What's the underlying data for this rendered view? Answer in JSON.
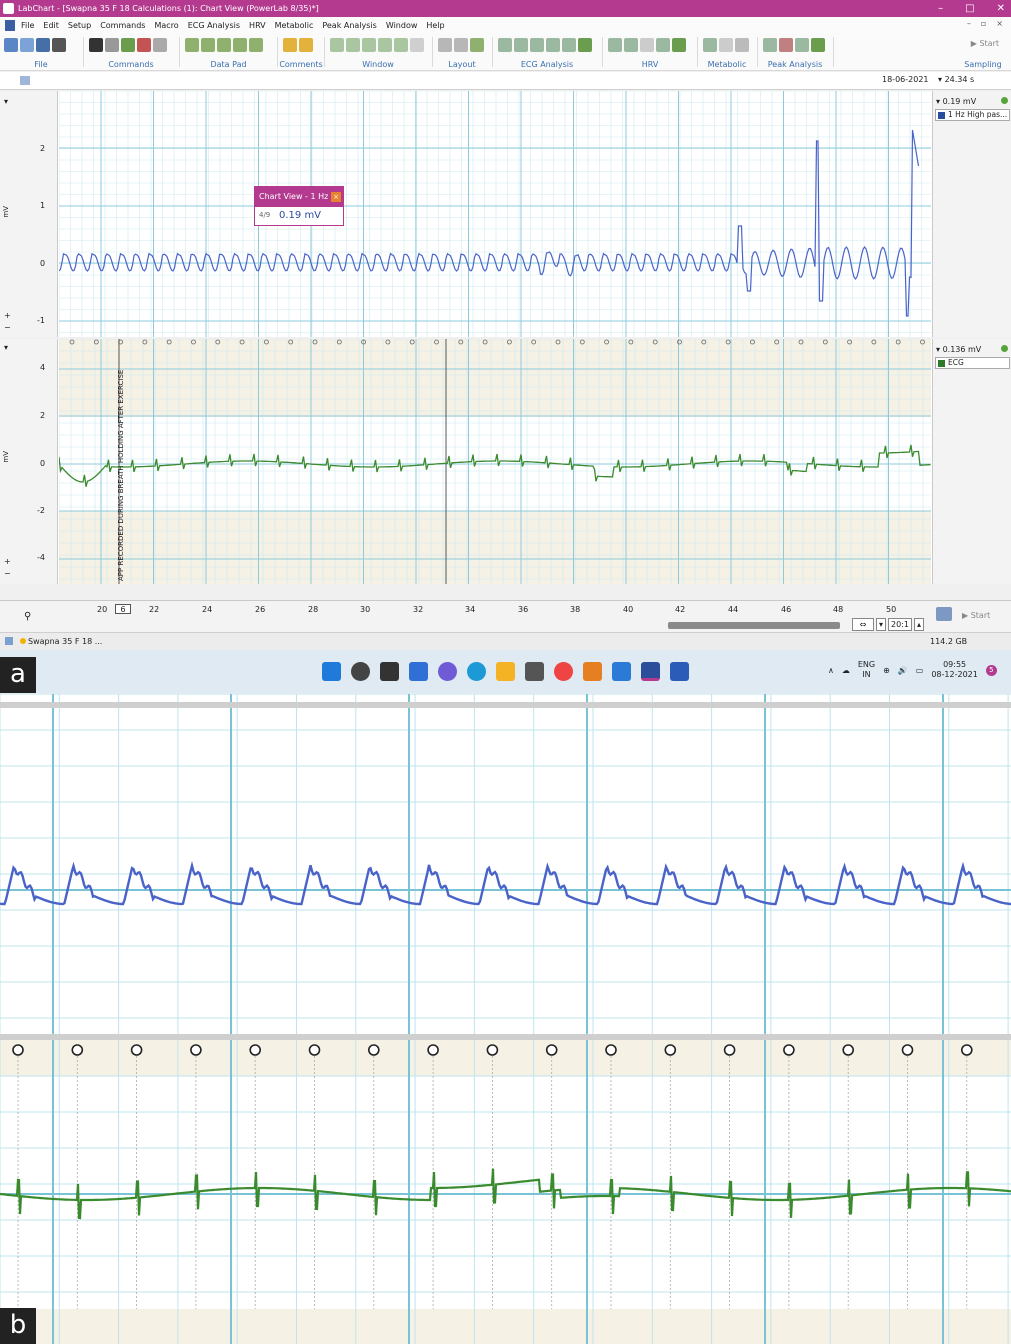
{
  "window": {
    "title": "LabChart - [Swapna 35 F 18 Calculations (1): Chart View (PowerLab 8/35)*]",
    "controls": [
      "–",
      "□",
      "✕"
    ]
  },
  "menu": [
    "File",
    "Edit",
    "Setup",
    "Commands",
    "Macro",
    "ECG Analysis",
    "HRV",
    "Metabolic",
    "Peak Analysis",
    "Window",
    "Help"
  ],
  "ribbon": {
    "groups": [
      "File",
      "Commands",
      "Data Pad",
      "Comments",
      "Window",
      "Layout",
      "ECG Analysis",
      "HRV",
      "Metabolic",
      "Peak Analysis",
      "Sampling"
    ],
    "start_label": "Start"
  },
  "date_bar": {
    "date": "18-06-2021",
    "duration": "24.34 s"
  },
  "channel1": {
    "unit": "mV",
    "ticks": [
      "2",
      "1",
      "0",
      "-1"
    ],
    "value": "0.19 mV",
    "selector": "1 Hz High pas...",
    "color": "#4a63c8"
  },
  "channel2": {
    "unit": "mV",
    "ticks": [
      "4",
      "2",
      "0",
      "-2",
      "-4"
    ],
    "value": "0.136 mV",
    "selector": "ECG",
    "color": "#3a8a2e",
    "comment": "APP RECORDED DURING BREATH HOLDING AFTER EXERCISE"
  },
  "popup": {
    "title": "Chart View - 1 Hz ...",
    "value": "0.19 mV",
    "icon": "4/9"
  },
  "time_axis": {
    "ticks": [
      "20",
      "22",
      "24",
      "26",
      "28",
      "30",
      "32",
      "34",
      "36",
      "38",
      "40",
      "42",
      "44",
      "46",
      "48",
      "50"
    ],
    "cursor_value": "6",
    "zoom_ratio": "20:1",
    "start_label": "Start"
  },
  "status": {
    "document": "Swapna 35 F 18 ...",
    "disk": "114.2 GB"
  },
  "taskbar": {
    "lang_top": "ENG",
    "lang_bottom": "IN",
    "time": "09:55",
    "date": "08-12-2021",
    "notification_count": "5"
  },
  "panel_labels": {
    "a": "a",
    "b": "b"
  },
  "colors": {
    "accent": "#b33a8f",
    "trace_blue": "#4a63c8",
    "trace_green": "#3a8a2e",
    "grid": "#9fd3e0"
  }
}
